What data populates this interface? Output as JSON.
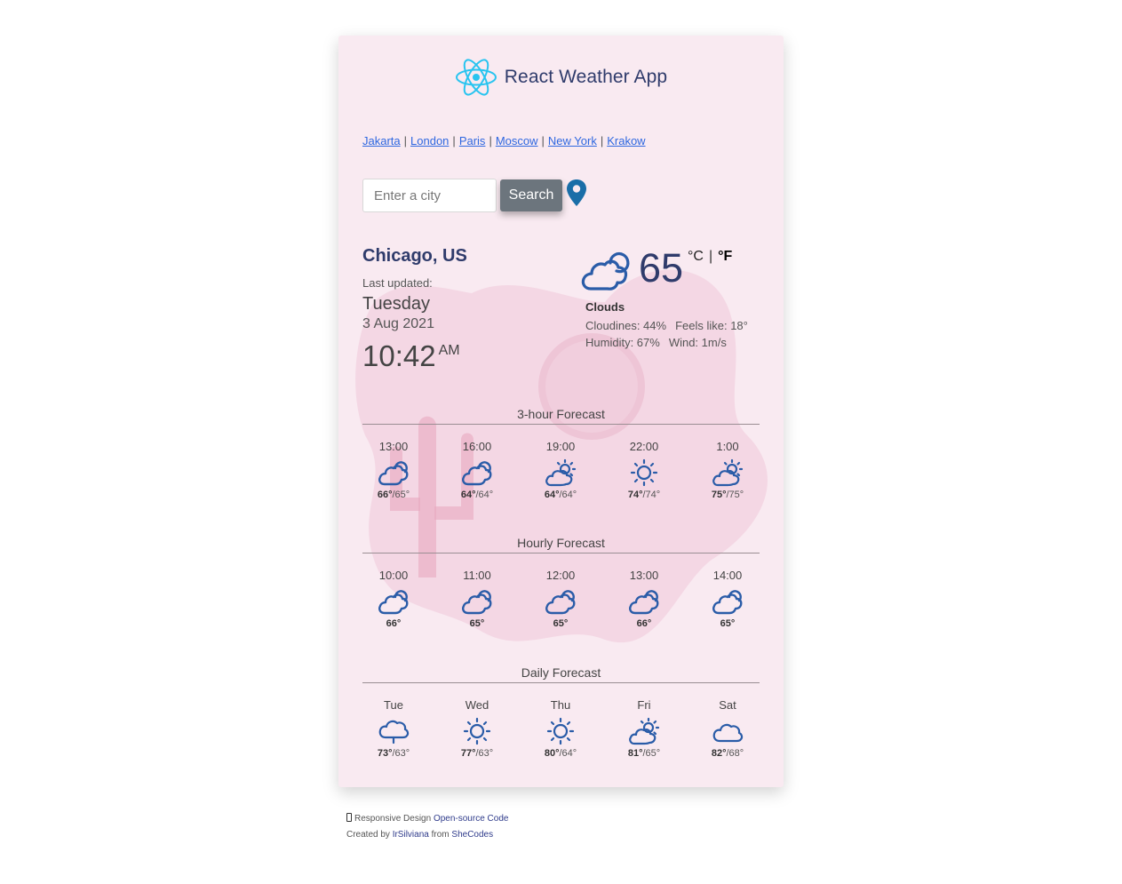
{
  "header": {
    "title": "React Weather App",
    "logo_icon": "react-logo-icon",
    "logo_color": "#28c4f0"
  },
  "cities": [
    "Jakarta",
    "London",
    "Paris",
    "Moscow",
    "New York",
    "Krakow"
  ],
  "search": {
    "placeholder": "Enter a city",
    "button_label": "Search",
    "location_icon": "map-pin-icon"
  },
  "current": {
    "city": "Chicago, US",
    "last_updated_label": "Last updated:",
    "day": "Tuesday",
    "date": "3 Aug 2021",
    "time": "10:42",
    "ampm": "AM",
    "temp": "65",
    "unit_c": "°C",
    "unit_sep": "|",
    "unit_f": "°F",
    "icon": "clouds-icon",
    "condition": "Clouds",
    "cloudiness": "Cloudines: 44%",
    "feels_like": "Feels like: 18°",
    "humidity": "Humidity: 67%",
    "wind": "Wind: 1m/s"
  },
  "three_hour": {
    "title": "3-hour Forecast",
    "items": [
      {
        "label": "13:00",
        "icon": "clouds",
        "hi": "66°",
        "lo": "/65°"
      },
      {
        "label": "16:00",
        "icon": "clouds",
        "hi": "64°",
        "lo": "/64°"
      },
      {
        "label": "19:00",
        "icon": "partly-sunny",
        "hi": "64°",
        "lo": "/64°"
      },
      {
        "label": "22:00",
        "icon": "sun",
        "hi": "74°",
        "lo": "/74°"
      },
      {
        "label": "1:00",
        "icon": "partly-sunny",
        "hi": "75°",
        "lo": "/75°"
      }
    ]
  },
  "hourly": {
    "title": "Hourly Forecast",
    "items": [
      {
        "label": "10:00",
        "icon": "clouds",
        "hi": "66°",
        "lo": ""
      },
      {
        "label": "11:00",
        "icon": "clouds",
        "hi": "65°",
        "lo": ""
      },
      {
        "label": "12:00",
        "icon": "clouds",
        "hi": "65°",
        "lo": ""
      },
      {
        "label": "13:00",
        "icon": "clouds",
        "hi": "66°",
        "lo": ""
      },
      {
        "label": "14:00",
        "icon": "clouds",
        "hi": "65°",
        "lo": ""
      }
    ]
  },
  "daily": {
    "title": "Daily Forecast",
    "items": [
      {
        "label": "Tue",
        "icon": "rain-cloud",
        "hi": "73°",
        "lo": "/63°"
      },
      {
        "label": "Wed",
        "icon": "sun",
        "hi": "77°",
        "lo": "/63°"
      },
      {
        "label": "Thu",
        "icon": "sun",
        "hi": "80°",
        "lo": "/64°"
      },
      {
        "label": "Fri",
        "icon": "partly-sunny",
        "hi": "81°",
        "lo": "/65°"
      },
      {
        "label": "Sat",
        "icon": "cloud",
        "hi": "82°",
        "lo": "/68°"
      }
    ]
  },
  "footer": {
    "device_icon": "mobile-phone-icon",
    "responsive_text": "Responsive Design",
    "source_link": "Open-source Code",
    "created_by": "Created by",
    "author_link": "IrSilviana",
    "from_text": "from",
    "org_link": "SheCodes"
  },
  "colors": {
    "accent": "#2f3b6b",
    "icon_blue": "#2a5ca8",
    "link": "#2e67e0",
    "button": "#6c757d",
    "card_bg": "#f9eaf1"
  }
}
